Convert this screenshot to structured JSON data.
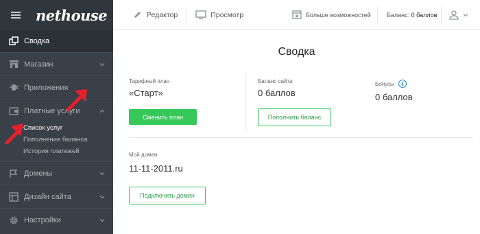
{
  "logo": "nethouse",
  "sidebar": {
    "items": [
      {
        "label": "Сводка"
      },
      {
        "label": "Магазин"
      },
      {
        "label": "Приложения"
      },
      {
        "label": "Платные услуги"
      },
      {
        "label": "Домены"
      },
      {
        "label": "Дизайн сайта"
      },
      {
        "label": "Настройки"
      }
    ],
    "subitems": [
      {
        "label": "Список услуг"
      },
      {
        "label": "Пополнение баланса"
      },
      {
        "label": "История платежей"
      }
    ]
  },
  "topbar": {
    "editor": "Редактор",
    "preview": "Просмотр",
    "more": "Больше возможностей",
    "balance_label": "Баланс:",
    "balance_value": "0 баллов"
  },
  "main": {
    "title": "Сводка",
    "plan_label": "Тарифный план",
    "plan_value": "«Старт»",
    "change_plan": "Сменить план",
    "balance_label": "Баланс сайта",
    "balance_value": "0 баллов",
    "topup": "Пополнить баланс",
    "bonus_label": "Бонусы",
    "bonus_value": "0 баллов",
    "domain_label": "Мой домен",
    "domain_value": "11-11-2011.ru",
    "connect_domain": "Подключить домен"
  },
  "colors": {
    "accent_green": "#36c95a",
    "sidebar_bg": "#3a4047",
    "annotation_red": "#e8202a",
    "info_blue": "#2a87d0"
  }
}
